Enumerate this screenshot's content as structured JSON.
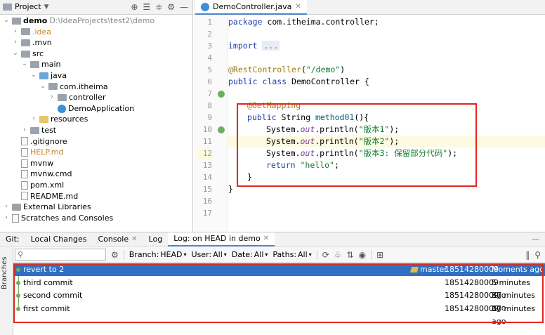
{
  "project_panel": {
    "title": "Project",
    "tree": [
      {
        "label": "demo",
        "suffix": "D:\\IdeaProjects\\test2\\demo",
        "depth": 0,
        "expanded": true,
        "icon": "folder-icon",
        "bold": true
      },
      {
        "label": ".idea",
        "depth": 1,
        "expanded": false,
        "icon": "folder-icon",
        "color": "orange"
      },
      {
        "label": ".mvn",
        "depth": 1,
        "expanded": false,
        "icon": "folder-icon"
      },
      {
        "label": "src",
        "depth": 1,
        "expanded": true,
        "icon": "folder-icon"
      },
      {
        "label": "main",
        "depth": 2,
        "expanded": true,
        "icon": "folder-icon"
      },
      {
        "label": "java",
        "depth": 3,
        "expanded": true,
        "icon": "source-folder-icon"
      },
      {
        "label": "com.itheima",
        "depth": 4,
        "expanded": true,
        "icon": "package-icon"
      },
      {
        "label": "controller",
        "depth": 5,
        "expanded": false,
        "icon": "package-icon"
      },
      {
        "label": "DemoApplication",
        "depth": 5,
        "icon": "java-class-icon"
      },
      {
        "label": "resources",
        "depth": 3,
        "expanded": false,
        "icon": "resources-folder-icon"
      },
      {
        "label": "test",
        "depth": 2,
        "expanded": false,
        "icon": "folder-icon"
      },
      {
        "label": ".gitignore",
        "depth": 1,
        "icon": "file-icon"
      },
      {
        "label": "HELP.md",
        "depth": 1,
        "icon": "markdown-icon",
        "color": "orange"
      },
      {
        "label": "mvnw",
        "depth": 1,
        "icon": "file-icon"
      },
      {
        "label": "mvnw.cmd",
        "depth": 1,
        "icon": "file-icon"
      },
      {
        "label": "pom.xml",
        "depth": 1,
        "icon": "maven-icon"
      },
      {
        "label": "README.md",
        "depth": 1,
        "icon": "markdown-icon"
      },
      {
        "label": "External Libraries",
        "depth": 0,
        "expanded": false,
        "icon": "library-icon"
      },
      {
        "label": "Scratches and Consoles",
        "depth": 0,
        "expanded": false,
        "icon": "scratches-icon"
      }
    ]
  },
  "editor": {
    "tab_label": "DemoController.java",
    "line_numbers": [
      "1",
      "2",
      "3",
      "4",
      "5",
      "6",
      "7",
      "8",
      "9",
      "10",
      "11",
      "12",
      "13",
      "14",
      "15",
      "16",
      "17"
    ],
    "highlighted_line": 12,
    "code": {
      "l1_kw": "package",
      "l1_rest": " com.itheima.controller;",
      "l3_kw": "import",
      "l3_fold": "...",
      "l6_ann": "@RestController",
      "l6_p1": "(",
      "l6_str": "\"/demo\"",
      "l6_p2": ")",
      "l7_kw1": "public",
      "l7_kw2": "class",
      "l7_rest": " DemoController {",
      "l9_ann": "@GetMapping",
      "l10_kw": "public",
      "l10_type": " String ",
      "l10_fn": "method01",
      "l10_rest": "(){",
      "l11_a": "System.",
      "l11_out": "out",
      "l11_b": ".println(",
      "l11_str": "\"版本1\"",
      "l11_c": ");",
      "l12_a": "System.",
      "l12_out": "out",
      "l12_b": ".println(",
      "l12_str": "\"版本2\"",
      "l12_c": ");",
      "l13_a": "System.",
      "l13_out": "out",
      "l13_b": ".println(",
      "l13_str": "\"版本3: 保留部分代码\"",
      "l13_c": ");",
      "l14_kw": "return",
      "l14_str": " \"hello\"",
      "l14_c": ";",
      "l15": "}",
      "l16": "}"
    }
  },
  "git_panel": {
    "prefix": "Git:",
    "tabs": [
      "Local Changes",
      "Console",
      "Log",
      "Log: on HEAD in demo"
    ],
    "side_label": "Branches",
    "search_placeholder": "",
    "filters": [
      {
        "label": "Branch:",
        "value": "HEAD"
      },
      {
        "label": "User:",
        "value": "All"
      },
      {
        "label": "Date:",
        "value": "All"
      },
      {
        "label": "Paths:",
        "value": "All"
      }
    ],
    "commits": [
      {
        "message": "revert to 2",
        "tag": "master",
        "author": "18514280009",
        "date": "Moments ago",
        "selected": true
      },
      {
        "message": "third commit",
        "tag": "",
        "author": "18514280009",
        "date": "5 minutes ago",
        "selected": false
      },
      {
        "message": "second commit",
        "tag": "",
        "author": "18514280009",
        "date": "37 minutes ago",
        "selected": false
      },
      {
        "message": "first commit",
        "tag": "",
        "author": "18514280009",
        "date": "37 minutes ago",
        "selected": false
      }
    ]
  },
  "colors": {
    "selection": "#2f70c2",
    "annotation_box": "#e0281f",
    "graph": "#6fae5c"
  }
}
